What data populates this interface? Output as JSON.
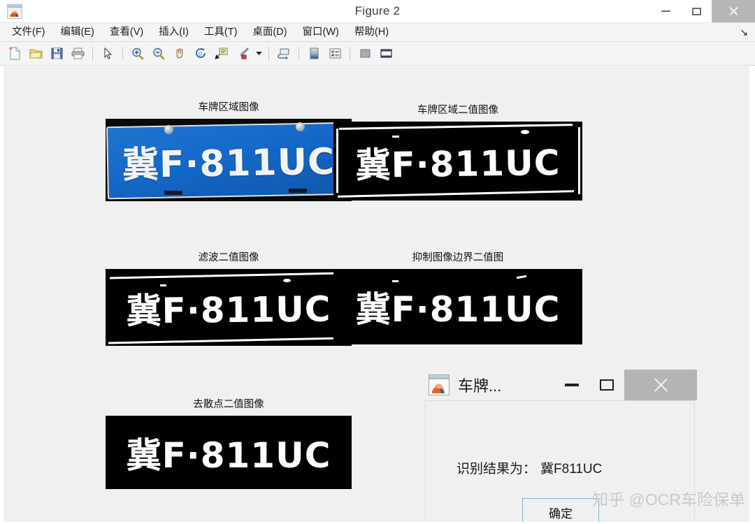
{
  "window": {
    "title": "Figure 2",
    "app_icon": "matlab-membrane-icon",
    "controls": {
      "minimize": "minimize-icon",
      "maximize": "maximize-icon",
      "close": "close-icon"
    }
  },
  "menubar": {
    "items": [
      {
        "label": "文件(F)",
        "name": "menu-file"
      },
      {
        "label": "编辑(E)",
        "name": "menu-edit"
      },
      {
        "label": "查看(V)",
        "name": "menu-view"
      },
      {
        "label": "插入(I)",
        "name": "menu-insert"
      },
      {
        "label": "工具(T)",
        "name": "menu-tools"
      },
      {
        "label": "桌面(D)",
        "name": "menu-desktop"
      },
      {
        "label": "窗口(W)",
        "name": "menu-window"
      },
      {
        "label": "帮助(H)",
        "name": "menu-help"
      }
    ],
    "overflow_glyph": "↘"
  },
  "toolbar": {
    "buttons": [
      {
        "name": "new-figure-icon",
        "glyph": "⬜"
      },
      {
        "name": "open-file-icon",
        "glyph": "📂"
      },
      {
        "name": "save-figure-icon",
        "glyph": "💾"
      },
      {
        "name": "print-figure-icon",
        "glyph": "🖨"
      },
      {
        "name": "pointer-icon",
        "glyph": "➤"
      },
      {
        "name": "zoom-in-icon",
        "glyph": "🔍"
      },
      {
        "name": "zoom-out-icon",
        "glyph": "🔍"
      },
      {
        "name": "pan-hand-icon",
        "glyph": "✋"
      },
      {
        "name": "rotate-3d-icon",
        "glyph": "↺"
      },
      {
        "name": "data-cursor-icon",
        "glyph": "🗒"
      },
      {
        "name": "brush-icon",
        "glyph": "🖌"
      },
      {
        "name": "brush-dropdown-icon",
        "glyph": "▾"
      },
      {
        "name": "link-data-icon",
        "glyph": "🔗"
      },
      {
        "name": "insert-colorbar-icon",
        "glyph": "▧"
      },
      {
        "name": "insert-legend-icon",
        "glyph": "≡"
      },
      {
        "name": "hide-plot-tools-icon",
        "glyph": "■"
      },
      {
        "name": "show-plot-tools-icon",
        "glyph": "▣"
      }
    ]
  },
  "figure": {
    "subplots": [
      {
        "name": "subplot-plate-region",
        "title": "车牌区域图像",
        "kind": "color-photo",
        "plate_text_cn": "冀",
        "plate_text_rest": "F·811UC"
      },
      {
        "name": "subplot-plate-binary",
        "title": "车牌区域二值图像",
        "kind": "binary",
        "plate_text_cn": "冀",
        "plate_text_rest": "F·811UC"
      },
      {
        "name": "subplot-filtered-binary",
        "title": "滤波二值图像",
        "kind": "binary",
        "plate_text_cn": "冀",
        "plate_text_rest": "F·811UC"
      },
      {
        "name": "subplot-suppressed-border-binary",
        "title": "抑制图像边界二值图",
        "kind": "binary",
        "plate_text_cn": "冀",
        "plate_text_rest": "F·811UC"
      },
      {
        "name": "subplot-despeckled-binary",
        "title": "去散点二值图像",
        "kind": "binary",
        "plate_text_cn": "冀",
        "plate_text_rest": "F·811UC"
      }
    ]
  },
  "dialog": {
    "title": "车牌...",
    "icon": "matlab-membrane-icon",
    "message_label": "识别结果为：",
    "message_value": "冀F811UC",
    "ok_button": "确定",
    "controls": {
      "minimize": "minimize-icon",
      "maximize": "maximize-icon",
      "close": "close-icon"
    }
  },
  "watermark": {
    "text": "知乎 @OCR车险保单"
  },
  "colors": {
    "plate_blue": "#1568c8",
    "plate_black": "#000000",
    "plate_white": "#ffffff",
    "canvas_bg": "#f0f0f0",
    "chrome_bg": "#f4f4f4",
    "close_btn_bg": "#b6b6b6",
    "ok_border": "#7eb4d8",
    "watermark": "#c9c9c9"
  }
}
